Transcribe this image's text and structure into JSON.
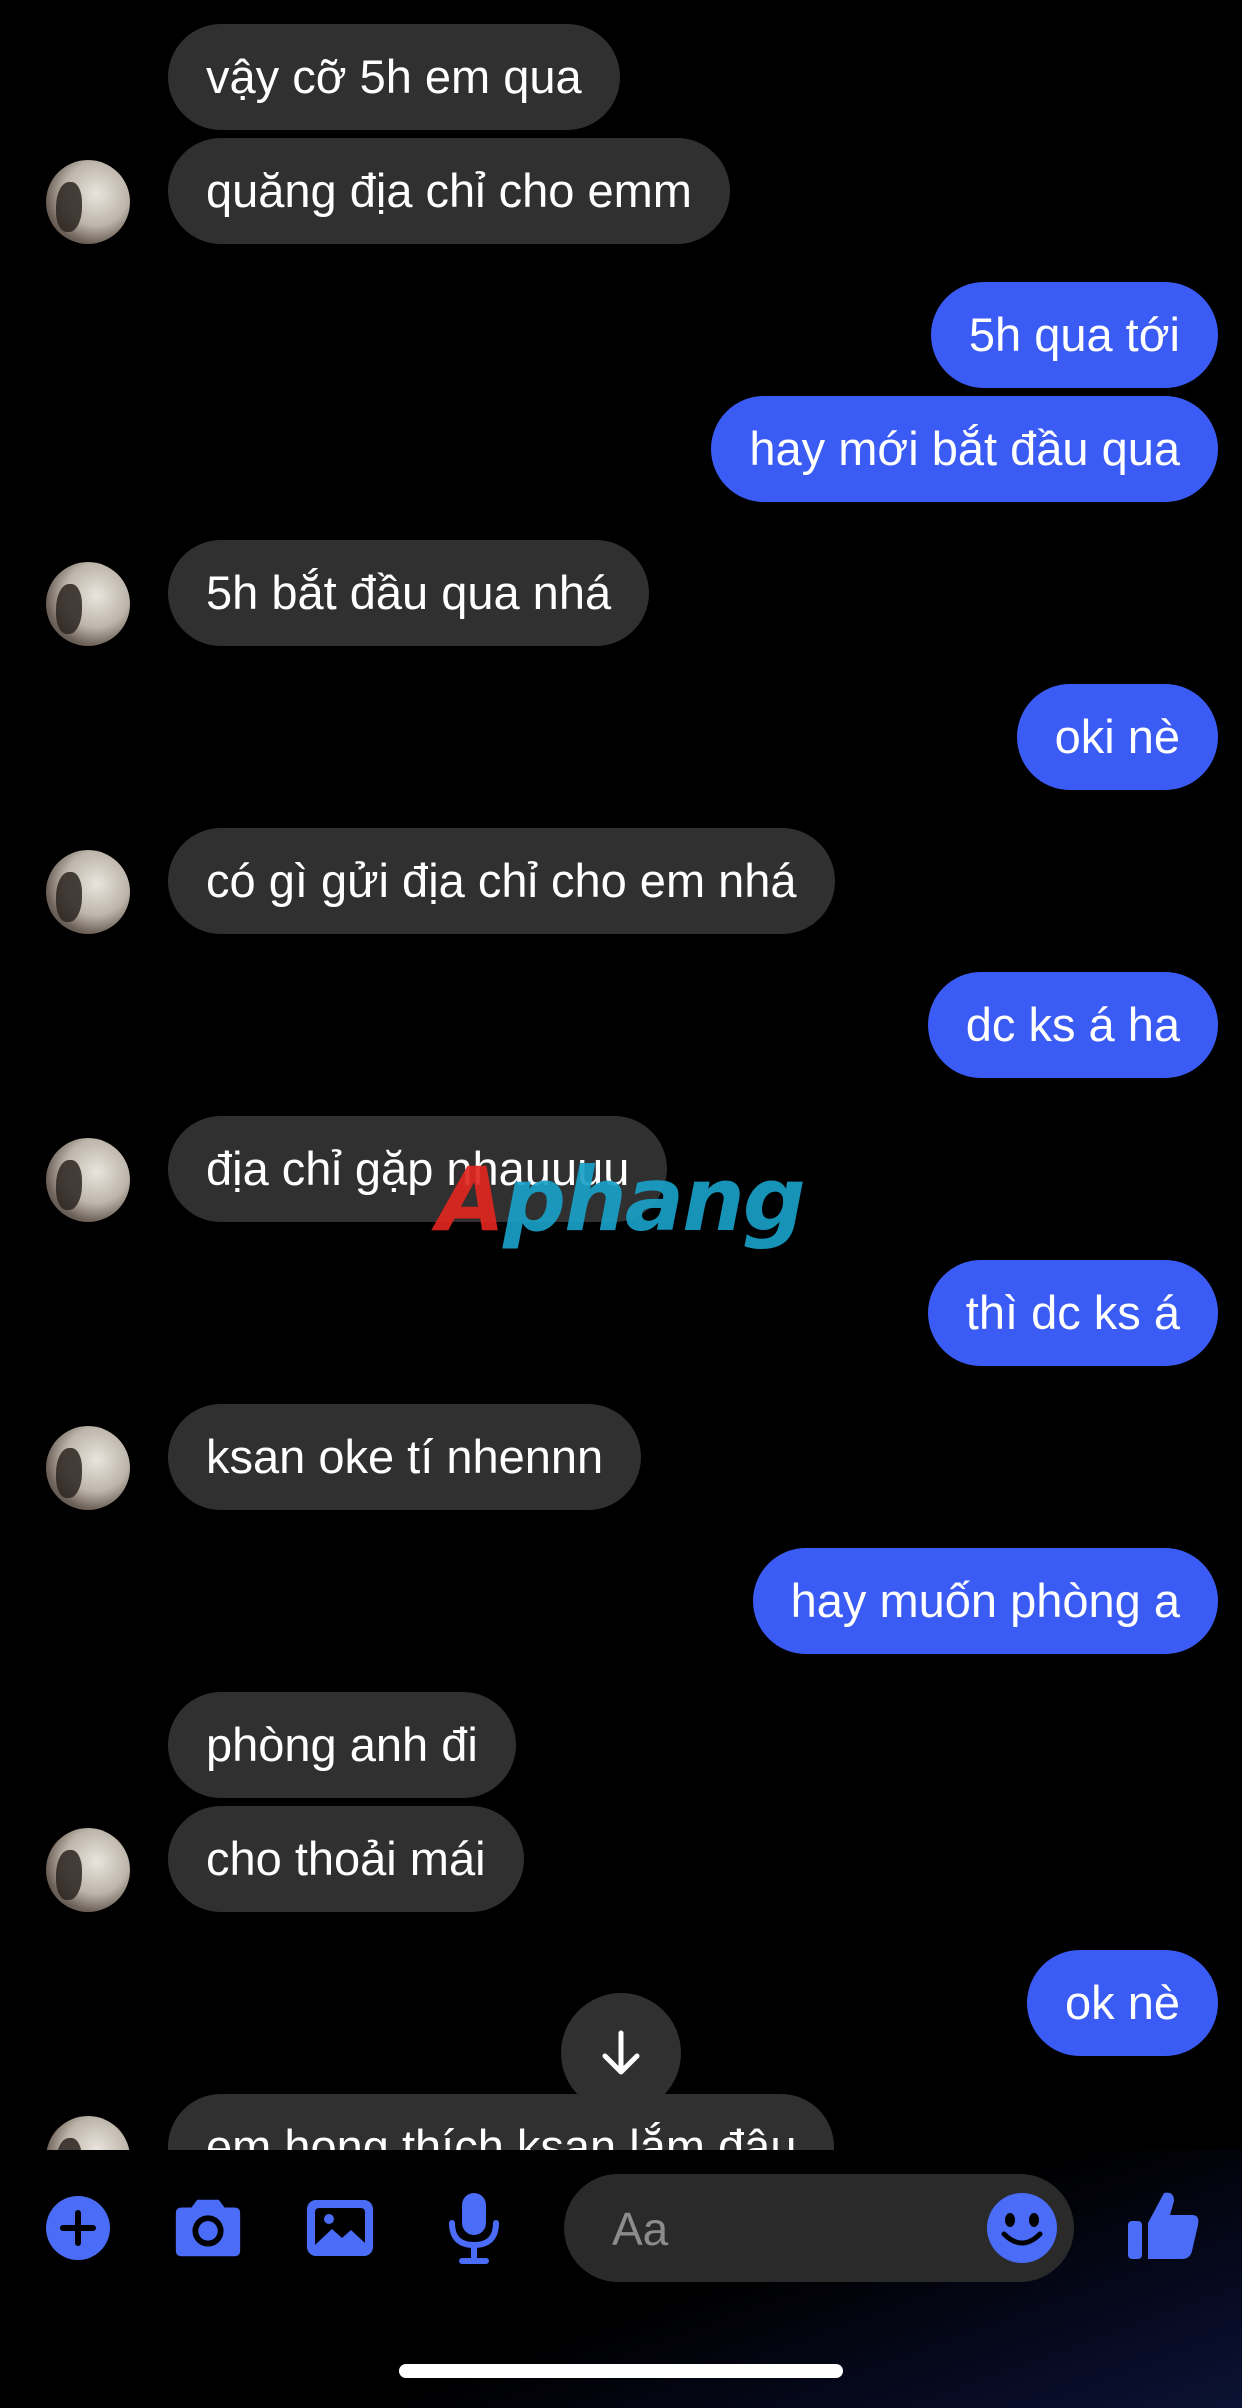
{
  "messages": [
    {
      "side": "in",
      "text": "vậy cỡ 5h em qua"
    },
    {
      "side": "in",
      "text": "quăng địa chỉ cho emm"
    },
    {
      "side": "out",
      "text": "5h qua tới"
    },
    {
      "side": "out",
      "text": "hay mới bắt đầu qua"
    },
    {
      "side": "in",
      "text": "5h bắt đầu qua nhá"
    },
    {
      "side": "out",
      "text": "oki nè"
    },
    {
      "side": "in",
      "text": "có gì gửi địa chỉ cho em nhá"
    },
    {
      "side": "out",
      "text": "dc ks á ha"
    },
    {
      "side": "in",
      "text": "địa chỉ gặp nhauuuu"
    },
    {
      "side": "out",
      "text": "thì dc ks á"
    },
    {
      "side": "in",
      "text": "ksan oke tí nhennn"
    },
    {
      "side": "out",
      "text": "hay muốn phòng a"
    },
    {
      "side": "in",
      "text": "phòng anh đi"
    },
    {
      "side": "in",
      "text": "cho thoải mái"
    },
    {
      "side": "out",
      "text": "ok nè"
    },
    {
      "side": "in",
      "text": "em hong thích ksan lắm đâu"
    }
  ],
  "watermark": {
    "first": "A",
    "rest": "phang"
  },
  "composer": {
    "input_placeholder": "Aa",
    "icons": [
      "plus-icon",
      "camera-icon",
      "image-icon",
      "microphone-icon",
      "emoji-icon",
      "thumbs-up-icon"
    ]
  },
  "colors": {
    "background": "#000000",
    "incoming_bubble": "#303030",
    "outgoing_bubble": "#3b5bf5",
    "accent": "#4a6cf7"
  }
}
